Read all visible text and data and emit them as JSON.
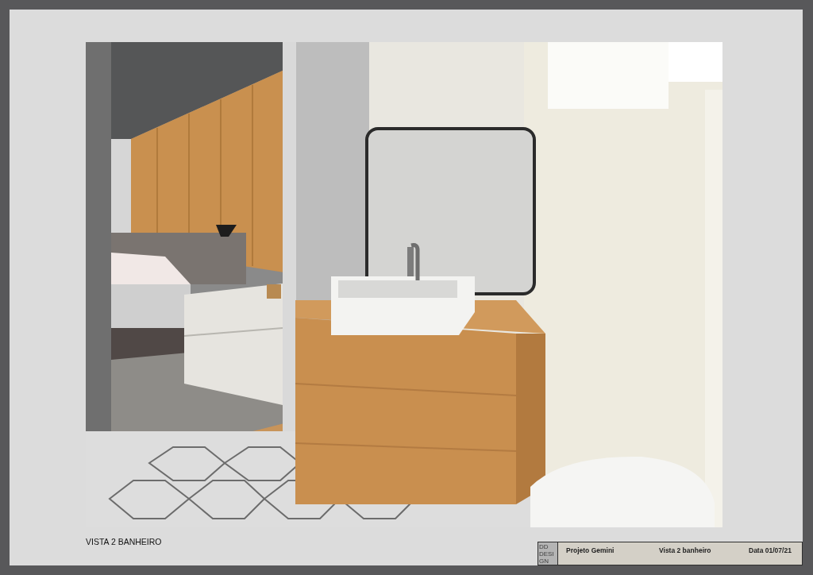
{
  "sheet": {
    "view_label": "VISTA 2 BANHEIRO"
  },
  "title_block": {
    "logo_lines": [
      "DD",
      "DESI",
      "GN"
    ],
    "project": "Projeto Gemini",
    "view": "Vista 2 banheiro",
    "date": "Data 01/07/21"
  }
}
